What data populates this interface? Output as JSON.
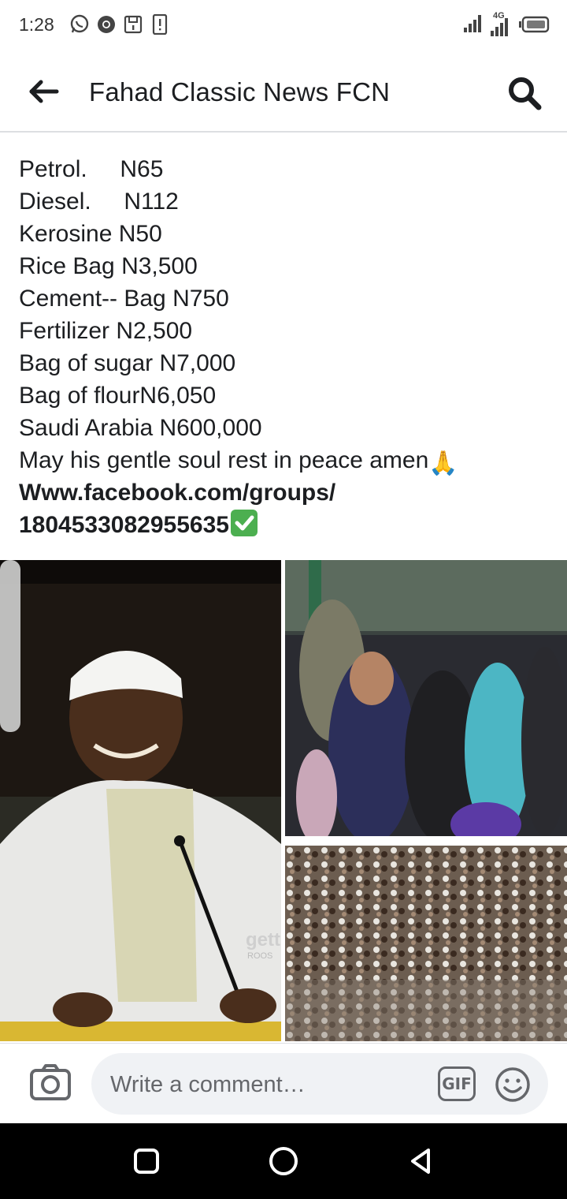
{
  "status_bar": {
    "time": "1:28",
    "network": "4G",
    "left_icons": [
      "whatsapp-icon",
      "chrome-icon",
      "sim-icon",
      "alert-icon"
    ],
    "right_icons": [
      "signal-icon",
      "signal-4g-icon",
      "battery-icon"
    ]
  },
  "header": {
    "title": "Fahad Classic News FCN",
    "back_icon": "arrow-left-icon",
    "search_icon": "search-icon"
  },
  "post": {
    "lines": [
      "Petrol.     N65",
      "Diesel.     N112",
      "Kerosine N50",
      "Rice Bag N3,500",
      "Cement-- Bag N750",
      "Fertilizer N2,500",
      "Bag of sugar N7,000",
      "Bag of flourN6,050",
      "Saudi Arabia N600,000",
      "May his gentle soul rest in peace amen"
    ],
    "pray_emoji": "🙏",
    "link_line1": "Www.facebook.com/groups/",
    "link_line2": "1804533082955635",
    "check_emoji": "✅"
  },
  "photos": {
    "watermark_main": "gett",
    "watermark_sub": "ROOS"
  },
  "comment_bar": {
    "placeholder": "Write a comment…",
    "gif_label": "GIF",
    "camera_icon": "camera-icon",
    "emoji_icon": "smiley-icon"
  },
  "nav_bar": {
    "icons": [
      "recents-icon",
      "home-icon",
      "back-triangle-icon"
    ]
  },
  "colors": {
    "text": "#1c1e21",
    "muted": "#65676b",
    "input_bg": "#f0f2f5",
    "divider": "#dddfe2",
    "nav_bg": "#000000"
  }
}
